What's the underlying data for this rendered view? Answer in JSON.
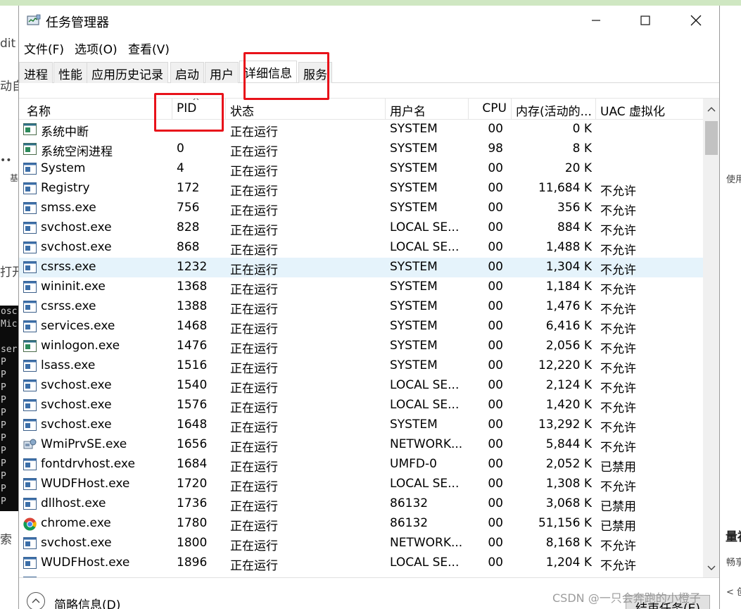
{
  "background": {
    "left_fragments": [
      "dit",
      "动自",
      "••",
      "基",
      "打开",
      "osc",
      "Mic",
      "ser",
      "P",
      "P",
      "P",
      "P",
      "P",
      "P",
      "P",
      "P",
      "P",
      "P",
      "P",
      "P",
      "索"
    ],
    "right_fragments": [
      "使用",
      "量福",
      "畅享",
      "< 创"
    ]
  },
  "window": {
    "title": "任务管理器",
    "menu": [
      "文件(F)",
      "选项(O)",
      "查看(V)"
    ],
    "tabs": [
      "进程",
      "性能",
      "应用历史记录",
      "启动",
      "用户",
      "详细信息",
      "服务"
    ],
    "active_tab": "详细信息"
  },
  "columns": [
    "名称",
    "PID",
    "状态",
    "用户名",
    "CPU",
    "内存(活动的...",
    "UAC 虚拟化"
  ],
  "sort_indicator": "^",
  "rows": [
    {
      "icon": "system-process-icon",
      "name": "系统中断",
      "pid": "",
      "status": "正在运行",
      "user": "SYSTEM",
      "cpu": "00",
      "mem": "0 K",
      "uac": ""
    },
    {
      "icon": "system-process-icon",
      "name": "系统空闲进程",
      "pid": "0",
      "status": "正在运行",
      "user": "SYSTEM",
      "cpu": "98",
      "mem": "8 K",
      "uac": ""
    },
    {
      "icon": "process-icon",
      "name": "System",
      "pid": "4",
      "status": "正在运行",
      "user": "SYSTEM",
      "cpu": "00",
      "mem": "20 K",
      "uac": ""
    },
    {
      "icon": "process-icon",
      "name": "Registry",
      "pid": "172",
      "status": "正在运行",
      "user": "SYSTEM",
      "cpu": "00",
      "mem": "11,684 K",
      "uac": "不允许"
    },
    {
      "icon": "process-icon",
      "name": "smss.exe",
      "pid": "756",
      "status": "正在运行",
      "user": "SYSTEM",
      "cpu": "00",
      "mem": "356 K",
      "uac": "不允许"
    },
    {
      "icon": "process-icon",
      "name": "svchost.exe",
      "pid": "828",
      "status": "正在运行",
      "user": "LOCAL SE...",
      "cpu": "00",
      "mem": "884 K",
      "uac": "不允许"
    },
    {
      "icon": "process-icon",
      "name": "svchost.exe",
      "pid": "868",
      "status": "正在运行",
      "user": "LOCAL SE...",
      "cpu": "00",
      "mem": "1,488 K",
      "uac": "不允许"
    },
    {
      "icon": "process-icon",
      "name": "csrss.exe",
      "pid": "1232",
      "status": "正在运行",
      "user": "SYSTEM",
      "cpu": "00",
      "mem": "1,304 K",
      "uac": "不允许",
      "selected": true
    },
    {
      "icon": "process-icon",
      "name": "wininit.exe",
      "pid": "1368",
      "status": "正在运行",
      "user": "SYSTEM",
      "cpu": "00",
      "mem": "1,184 K",
      "uac": "不允许"
    },
    {
      "icon": "process-icon",
      "name": "csrss.exe",
      "pid": "1388",
      "status": "正在运行",
      "user": "SYSTEM",
      "cpu": "00",
      "mem": "1,476 K",
      "uac": "不允许"
    },
    {
      "icon": "process-icon",
      "name": "services.exe",
      "pid": "1468",
      "status": "正在运行",
      "user": "SYSTEM",
      "cpu": "00",
      "mem": "6,416 K",
      "uac": "不允许"
    },
    {
      "icon": "system-process-icon",
      "name": "winlogon.exe",
      "pid": "1476",
      "status": "正在运行",
      "user": "SYSTEM",
      "cpu": "00",
      "mem": "2,056 K",
      "uac": "不允许"
    },
    {
      "icon": "process-icon",
      "name": "lsass.exe",
      "pid": "1516",
      "status": "正在运行",
      "user": "SYSTEM",
      "cpu": "00",
      "mem": "12,220 K",
      "uac": "不允许"
    },
    {
      "icon": "process-icon",
      "name": "svchost.exe",
      "pid": "1540",
      "status": "正在运行",
      "user": "LOCAL SE...",
      "cpu": "00",
      "mem": "2,124 K",
      "uac": "不允许"
    },
    {
      "icon": "process-icon",
      "name": "svchost.exe",
      "pid": "1576",
      "status": "正在运行",
      "user": "LOCAL SE...",
      "cpu": "00",
      "mem": "1,420 K",
      "uac": "不允许"
    },
    {
      "icon": "process-icon",
      "name": "svchost.exe",
      "pid": "1648",
      "status": "正在运行",
      "user": "SYSTEM",
      "cpu": "00",
      "mem": "13,292 K",
      "uac": "不允许"
    },
    {
      "icon": "wmi-icon",
      "name": "WmiPrvSE.exe",
      "pid": "1656",
      "status": "正在运行",
      "user": "NETWORK...",
      "cpu": "00",
      "mem": "5,844 K",
      "uac": "不允许"
    },
    {
      "icon": "process-icon",
      "name": "fontdrvhost.exe",
      "pid": "1684",
      "status": "正在运行",
      "user": "UMFD-0",
      "cpu": "00",
      "mem": "2,052 K",
      "uac": "已禁用"
    },
    {
      "icon": "process-icon",
      "name": "WUDFHost.exe",
      "pid": "1720",
      "status": "正在运行",
      "user": "LOCAL SE...",
      "cpu": "00",
      "mem": "1,308 K",
      "uac": "不允许"
    },
    {
      "icon": "process-icon",
      "name": "dllhost.exe",
      "pid": "1736",
      "status": "正在运行",
      "user": "86132",
      "cpu": "00",
      "mem": "3,068 K",
      "uac": "已禁用"
    },
    {
      "icon": "chrome-icon",
      "name": "chrome.exe",
      "pid": "1780",
      "status": "正在运行",
      "user": "86132",
      "cpu": "00",
      "mem": "51,156 K",
      "uac": "已禁用"
    },
    {
      "icon": "process-icon",
      "name": "svchost.exe",
      "pid": "1800",
      "status": "正在运行",
      "user": "NETWORK...",
      "cpu": "00",
      "mem": "8,168 K",
      "uac": "不允许"
    },
    {
      "icon": "process-icon",
      "name": "WUDFHost.exe",
      "pid": "1896",
      "status": "正在运行",
      "user": "LOCAL SE...",
      "cpu": "00",
      "mem": "1,204 K",
      "uac": "不允许"
    },
    {
      "icon": "process-icon",
      "name": "",
      "pid": "",
      "status": "",
      "user": "",
      "cpu": "",
      "mem": "",
      "uac": ""
    }
  ],
  "footer": {
    "fewer_details": "简略信息(D)",
    "end_task": "结束任务(E)"
  },
  "watermark": "CSDN @一只会奔跑的小橙子",
  "colors": {
    "highlight_box": "#e8121a",
    "selected_row": "#e5f3fb",
    "top_strip": "#cfe7c2"
  }
}
